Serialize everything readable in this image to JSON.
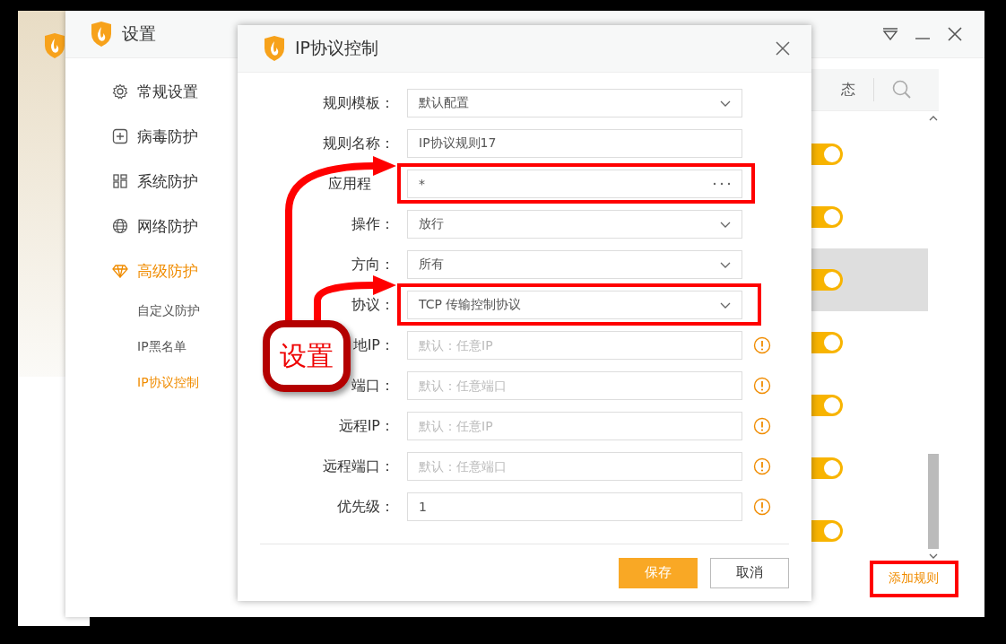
{
  "main_window": {
    "title": "设置",
    "sidebar": [
      {
        "label": "常规设置",
        "kind": "gear",
        "selected": false
      },
      {
        "label": "病毒防护",
        "kind": "plus",
        "selected": false
      },
      {
        "label": "系统防护",
        "kind": "blocks",
        "selected": false
      },
      {
        "label": "网络防护",
        "kind": "globe",
        "selected": false
      },
      {
        "label": "高级防护",
        "kind": "gem",
        "selected": true,
        "children": [
          {
            "label": "自定义防护",
            "selected": false
          },
          {
            "label": "IP黑名单",
            "selected": false
          },
          {
            "label": "IP协议控制",
            "selected": true
          }
        ]
      }
    ],
    "header": {
      "column_label": "态"
    },
    "rules": [
      {
        "on": true,
        "selected": false
      },
      {
        "on": true,
        "selected": false
      },
      {
        "on": true,
        "selected": true
      },
      {
        "on": true,
        "selected": false
      },
      {
        "on": true,
        "selected": false
      },
      {
        "on": true,
        "selected": false
      },
      {
        "on": true,
        "selected": false
      }
    ],
    "add_button": "添加规则"
  },
  "dialog": {
    "title": "IP协议控制",
    "fields": [
      {
        "label": "规则模板：",
        "kind": "select",
        "value": "默认配置",
        "info": false
      },
      {
        "label": "规则名称：",
        "kind": "text",
        "value": "IP协议规则17",
        "info": false
      },
      {
        "label": "应用程",
        "kind": "picker",
        "value": "*",
        "info": false
      },
      {
        "label": "操作：",
        "kind": "select",
        "value": "放行",
        "info": false
      },
      {
        "label": "方向：",
        "kind": "select",
        "value": "所有",
        "info": false
      },
      {
        "label": "协议：",
        "kind": "select",
        "value": "TCP 传输控制协议",
        "info": false
      },
      {
        "label": "地IP：",
        "kind": "text",
        "placeholder": "默认：任意IP",
        "info": true
      },
      {
        "label": "端口：",
        "kind": "text",
        "placeholder": "默认：任意端口",
        "info": true
      },
      {
        "label": "远程IP：",
        "kind": "text",
        "placeholder": "默认：任意IP",
        "info": true
      },
      {
        "label": "远程端口：",
        "kind": "text",
        "placeholder": "默认：任意端口",
        "info": true
      },
      {
        "label": "优先级：",
        "kind": "text",
        "value": "1",
        "info": true
      }
    ],
    "buttons": [
      {
        "label": "保存",
        "kind": "primary"
      },
      {
        "label": "取消",
        "kind": "secondary"
      }
    ]
  },
  "annotation": {
    "callout": "设置"
  }
}
